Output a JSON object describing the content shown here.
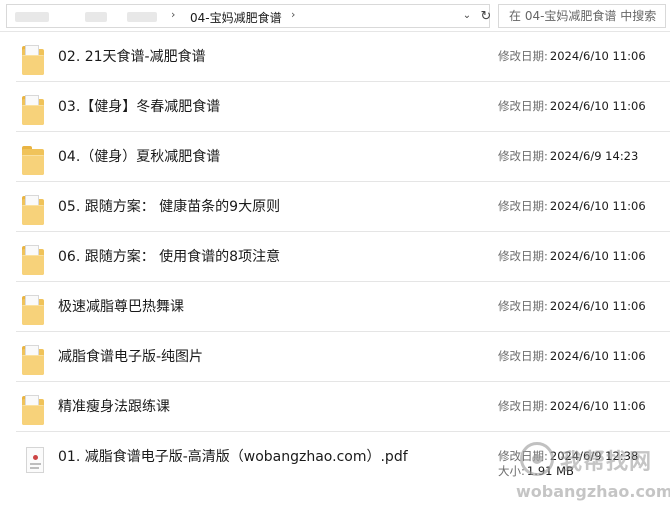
{
  "address_bar": {
    "current_folder": "04-宝妈减肥食谱",
    "separator": "›",
    "search_placeholder": "在 04-宝妈减肥食谱 中搜索"
  },
  "meta_labels": {
    "modified": "修改日期:",
    "size": "大小:"
  },
  "files": [
    {
      "name": "02. 21天食谱-减肥食谱",
      "modified": "2024/6/10 11:06",
      "type": "folder",
      "icon": "folder-icon"
    },
    {
      "name": "03.【健身】冬春减肥食谱",
      "modified": "2024/6/10 11:06",
      "type": "folder",
      "icon": "folder-icon"
    },
    {
      "name": "04.（健身）夏秋减肥食谱",
      "modified": "2024/6/9 14:23",
      "type": "folder",
      "icon": "folder-icon"
    },
    {
      "name": "05. 跟随方案： 健康苗条的9大原则",
      "modified": "2024/6/10 11:06",
      "type": "folder",
      "icon": "folder-icon"
    },
    {
      "name": "06. 跟随方案： 使用食谱的8项注意",
      "modified": "2024/6/10 11:06",
      "type": "folder",
      "icon": "folder-icon"
    },
    {
      "name": "极速减脂尊巴热舞课",
      "modified": "2024/6/10 11:06",
      "type": "folder",
      "icon": "folder-icon"
    },
    {
      "name": "减脂食谱电子版-纯图片",
      "modified": "2024/6/10 11:06",
      "type": "folder",
      "icon": "folder-icon"
    },
    {
      "name": "精准瘦身法跟练课",
      "modified": "2024/6/10 11:06",
      "type": "folder",
      "icon": "folder-icon"
    },
    {
      "name": "01. 减脂食谱电子版-高清版（wobangzhao.com）.pdf",
      "modified": "2024/6/9 12:38",
      "size": "1.91 MB",
      "type": "pdf",
      "icon": "pdf-file-icon"
    }
  ],
  "watermark": {
    "name": "我帮找网",
    "url": "wobangzhao.com"
  }
}
